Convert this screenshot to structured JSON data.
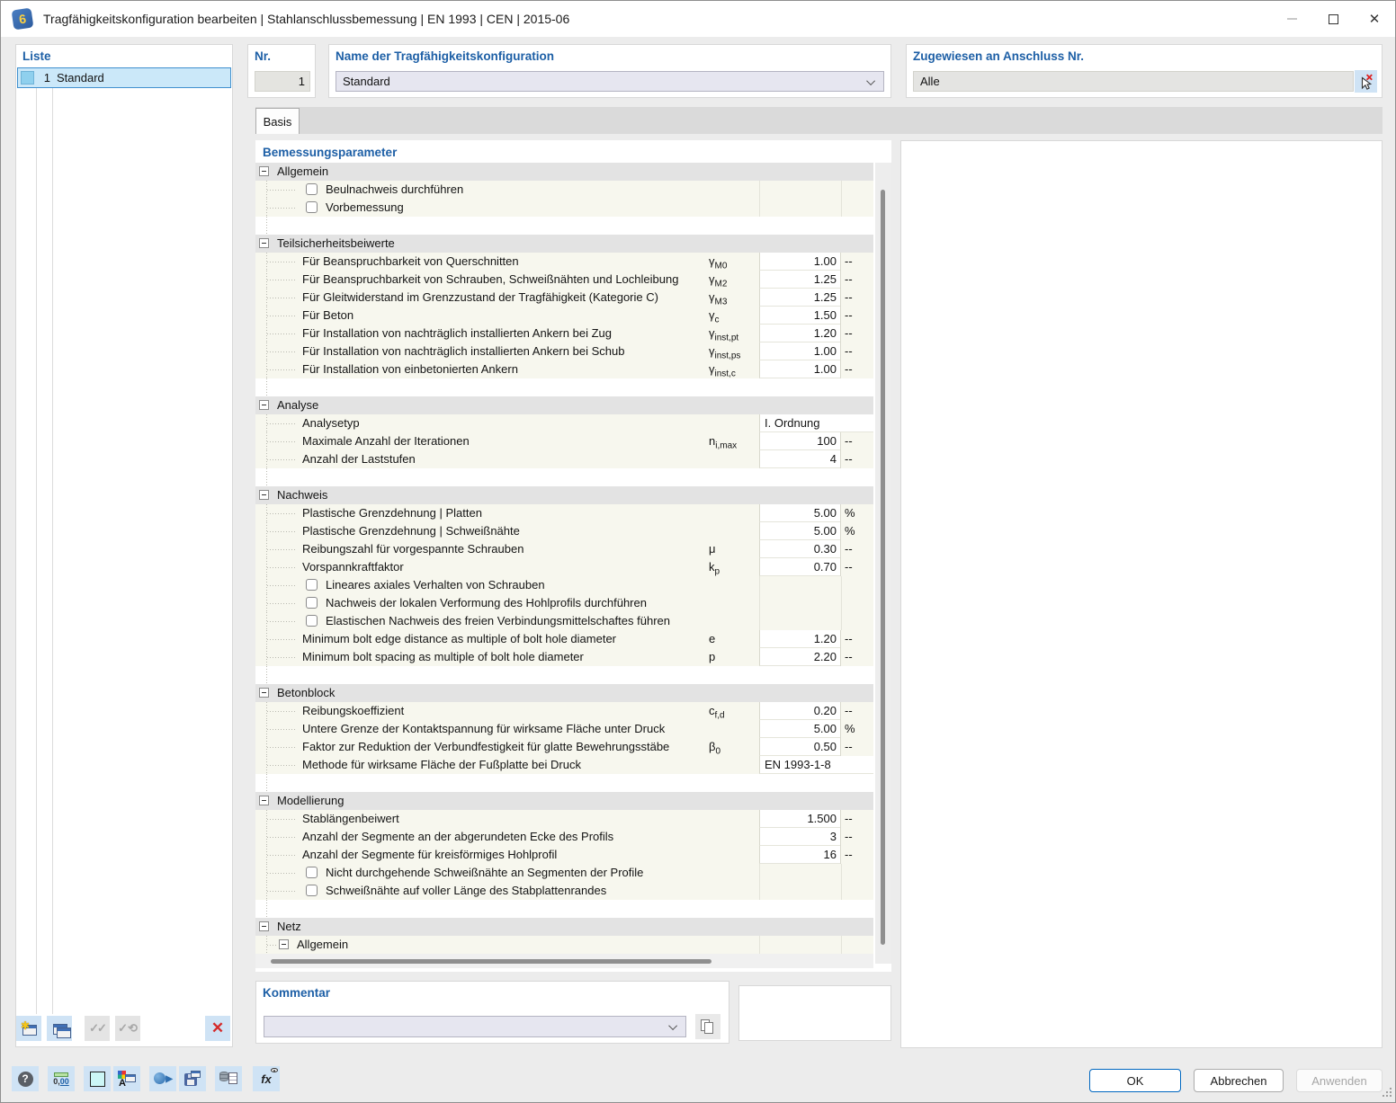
{
  "window": {
    "title": "Tragfähigkeitskonfiguration bearbeiten | Stahlanschlussbemessung | EN 1993 | CEN | 2015-06",
    "app_badge": "6"
  },
  "liste": {
    "label": "Liste",
    "rows": [
      {
        "nr": "1",
        "name": "Standard"
      }
    ]
  },
  "fields": {
    "nr_label": "Nr.",
    "nr_value": "1",
    "name_label": "Name der Tragfähigkeitskonfiguration",
    "name_value": "Standard",
    "assigned_label": "Zugewiesen an Anschluss Nr.",
    "assigned_value": "Alle"
  },
  "tabs": {
    "basis": "Basis"
  },
  "parameters": {
    "title": "Bemessungsparameter",
    "sections": [
      {
        "label": "Allgemein",
        "rows": [
          {
            "type": "checkbox",
            "label": "Beulnachweis durchführen",
            "checked": false
          },
          {
            "type": "checkbox",
            "label": "Vorbemessung",
            "checked": false
          },
          {
            "type": "spacer"
          }
        ]
      },
      {
        "label": "Teilsicherheitsbeiwerte",
        "rows": [
          {
            "type": "value",
            "label": "Für Beanspruchbarkeit von Querschnitten",
            "sym": "γ",
            "sub": "M0",
            "value": "1.00",
            "unit": "--"
          },
          {
            "type": "value",
            "label": "Für Beanspruchbarkeit von Schrauben, Schweißnähten und Lochleibung",
            "sym": "γ",
            "sub": "M2",
            "value": "1.25",
            "unit": "--"
          },
          {
            "type": "value",
            "label": "Für Gleitwiderstand im Grenzzustand der Tragfähigkeit (Kategorie C)",
            "sym": "γ",
            "sub": "M3",
            "value": "1.25",
            "unit": "--"
          },
          {
            "type": "value",
            "label": "Für Beton",
            "sym": "γ",
            "sub": "c",
            "value": "1.50",
            "unit": "--"
          },
          {
            "type": "value",
            "label": "Für Installation von nachträglich installierten Ankern bei Zug",
            "sym": "γ",
            "sub": "inst,pt",
            "value": "1.20",
            "unit": "--"
          },
          {
            "type": "value",
            "label": "Für Installation von nachträglich installierten Ankern bei Schub",
            "sym": "γ",
            "sub": "inst,ps",
            "value": "1.00",
            "unit": "--"
          },
          {
            "type": "value",
            "label": "Für Installation von einbetonierten Ankern",
            "sym": "γ",
            "sub": "inst,c",
            "value": "1.00",
            "unit": "--"
          },
          {
            "type": "spacer"
          }
        ]
      },
      {
        "label": "Analyse",
        "rows": [
          {
            "type": "value",
            "label": "Analysetyp",
            "value": "I. Ordnung",
            "align": "left"
          },
          {
            "type": "value",
            "label": "Maximale Anzahl der Iterationen",
            "sym": "n",
            "sub": "i,max",
            "value": "100",
            "unit": "--"
          },
          {
            "type": "value",
            "label": "Anzahl der Laststufen",
            "value": "4",
            "unit": "--"
          },
          {
            "type": "spacer"
          }
        ]
      },
      {
        "label": "Nachweis",
        "rows": [
          {
            "type": "value",
            "label": "Plastische Grenzdehnung | Platten",
            "value": "5.00",
            "unit": "%"
          },
          {
            "type": "value",
            "label": "Plastische Grenzdehnung | Schweißnähte",
            "value": "5.00",
            "unit": "%"
          },
          {
            "type": "value",
            "label": "Reibungszahl für vorgespannte Schrauben",
            "sym": "μ",
            "value": "0.30",
            "unit": "--"
          },
          {
            "type": "value",
            "label": "Vorspannkraftfaktor",
            "sym": "k",
            "sub": "p",
            "value": "0.70",
            "unit": "--"
          },
          {
            "type": "checkbox",
            "label": "Lineares axiales Verhalten von Schrauben",
            "checked": false
          },
          {
            "type": "checkbox",
            "label": "Nachweis der lokalen Verformung des Hohlprofils durchführen",
            "checked": false
          },
          {
            "type": "checkbox",
            "label": "Elastischen Nachweis des freien Verbindungsmittelschaftes führen",
            "checked": false
          },
          {
            "type": "value",
            "label": "Minimum bolt edge distance as multiple of bolt hole diameter",
            "sym": "e",
            "value": "1.20",
            "unit": "--"
          },
          {
            "type": "value",
            "label": "Minimum bolt spacing as multiple of bolt hole diameter",
            "sym": "p",
            "value": "2.20",
            "unit": "--"
          },
          {
            "type": "spacer"
          }
        ]
      },
      {
        "label": "Betonblock",
        "rows": [
          {
            "type": "value",
            "label": "Reibungskoeffizient",
            "sym": "c",
            "sub": "f,d",
            "value": "0.20",
            "unit": "--"
          },
          {
            "type": "value",
            "label": "Untere Grenze der Kontaktspannung für wirksame Fläche unter Druck",
            "value": "5.00",
            "unit": "%"
          },
          {
            "type": "value",
            "label": "Faktor zur Reduktion der Verbundfestigkeit für glatte Bewehrungsstäbe",
            "sym": "β",
            "sub": "0",
            "value": "0.50",
            "unit": "--"
          },
          {
            "type": "value",
            "label": "Methode für wirksame Fläche der Fußplatte bei Druck",
            "value": "EN 1993-1-8",
            "align": "left"
          },
          {
            "type": "spacer"
          }
        ]
      },
      {
        "label": "Modellierung",
        "rows": [
          {
            "type": "value",
            "label": "Stablängenbeiwert",
            "value": "1.500",
            "unit": "--"
          },
          {
            "type": "value",
            "label": "Anzahl der Segmente an der abgerundeten Ecke des Profils",
            "value": "3",
            "unit": "--"
          },
          {
            "type": "value",
            "label": "Anzahl der Segmente für kreisförmiges Hohlprofil",
            "value": "16",
            "unit": "--"
          },
          {
            "type": "checkbox",
            "label": "Nicht durchgehende Schweißnähte an Segmenten der Profile",
            "checked": false
          },
          {
            "type": "checkbox",
            "label": "Schweißnähte auf voller Länge des Stabplattenrandes",
            "checked": false
          },
          {
            "type": "spacer"
          }
        ]
      },
      {
        "label": "Netz",
        "rows": [
          {
            "type": "subsection",
            "label": "Allgemein"
          },
          {
            "type": "clipped"
          }
        ]
      }
    ]
  },
  "kommentar": {
    "label": "Kommentar",
    "value": ""
  },
  "toolbars": {
    "liste": [
      {
        "name": "new-config-button",
        "icon": "new-window-icon",
        "enabled": true
      },
      {
        "name": "copy-config-button",
        "icon": "copy-window-icon",
        "enabled": true
      },
      {
        "name": "check-all-button",
        "icon": "check-all-icon",
        "enabled": false
      },
      {
        "name": "reset-checks-button",
        "icon": "reset-checks-icon",
        "enabled": false
      },
      {
        "name": "delete-config-button",
        "icon": "delete-x-icon",
        "enabled": true
      }
    ],
    "bottom": [
      {
        "name": "help-button",
        "icon": "help-icon"
      },
      {
        "name": "units-settings-button",
        "icon": "units-icon",
        "text": "0,00"
      },
      {
        "name": "color-settings-button",
        "icon": "color-swatch-icon"
      },
      {
        "name": "display-properties-button",
        "icon": "font-color-icon"
      },
      {
        "name": "transfer-button",
        "icon": "transfer-icon"
      },
      {
        "name": "save-defaults-button",
        "icon": "save-icon"
      },
      {
        "name": "import-export-button",
        "icon": "database-icon"
      },
      {
        "name": "formula-view-button",
        "icon": "formula-icon",
        "text": "fx"
      }
    ]
  },
  "footer": {
    "ok": "OK",
    "cancel": "Abbrechen",
    "apply": "Anwenden"
  },
  "colors": {
    "label_blue": "#1d5fa6",
    "row_cream": "#f7f7ee",
    "section_gray": "#e3e3e3",
    "selection_blue": "#cbe8f9",
    "toolbar_blue": "#cfe3f5",
    "ok_border_blue": "#0067c0",
    "delete_red": "#d42a2a"
  }
}
